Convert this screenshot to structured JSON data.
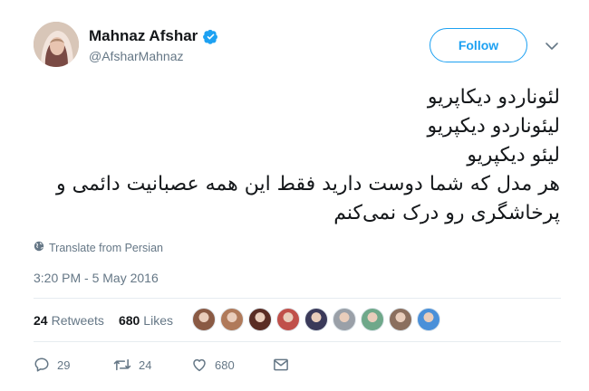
{
  "author": {
    "display_name": "Mahnaz Afshar",
    "handle": "@AfsharMahnaz",
    "verified": true
  },
  "follow_button": {
    "label": "Follow"
  },
  "tweet": {
    "lines": [
      "لئوناردو دیکاپریو",
      "لیئوناردو دیکپریو",
      "لیئو دیکپریو",
      "هر مدل که شما دوست دارید فقط این همه عصبانیت دائمی و",
      "پرخاشگری رو درک نمی‌کنم"
    ]
  },
  "translate": {
    "label": "Translate from Persian"
  },
  "timestamp": "3:20 PM - 5 May 2016",
  "stats": {
    "retweets_count": "24",
    "retweets_label": "Retweets",
    "likes_count": "680",
    "likes_label": "Likes"
  },
  "likers": [
    {
      "color": "#8a5a44"
    },
    {
      "color": "#b07a5a"
    },
    {
      "color": "#5a2d24"
    },
    {
      "color": "#c0504a"
    },
    {
      "color": "#3b3a5a"
    },
    {
      "color": "#9aa0a8"
    },
    {
      "color": "#6fa88a"
    },
    {
      "color": "#8b6f5e"
    },
    {
      "color": "#4a90d9"
    }
  ],
  "actions": {
    "reply_count": "29",
    "retweet_count": "24",
    "like_count": "680"
  },
  "colors": {
    "accent": "#1da1f2",
    "muted": "#657786",
    "divider": "#e6ecf0"
  }
}
